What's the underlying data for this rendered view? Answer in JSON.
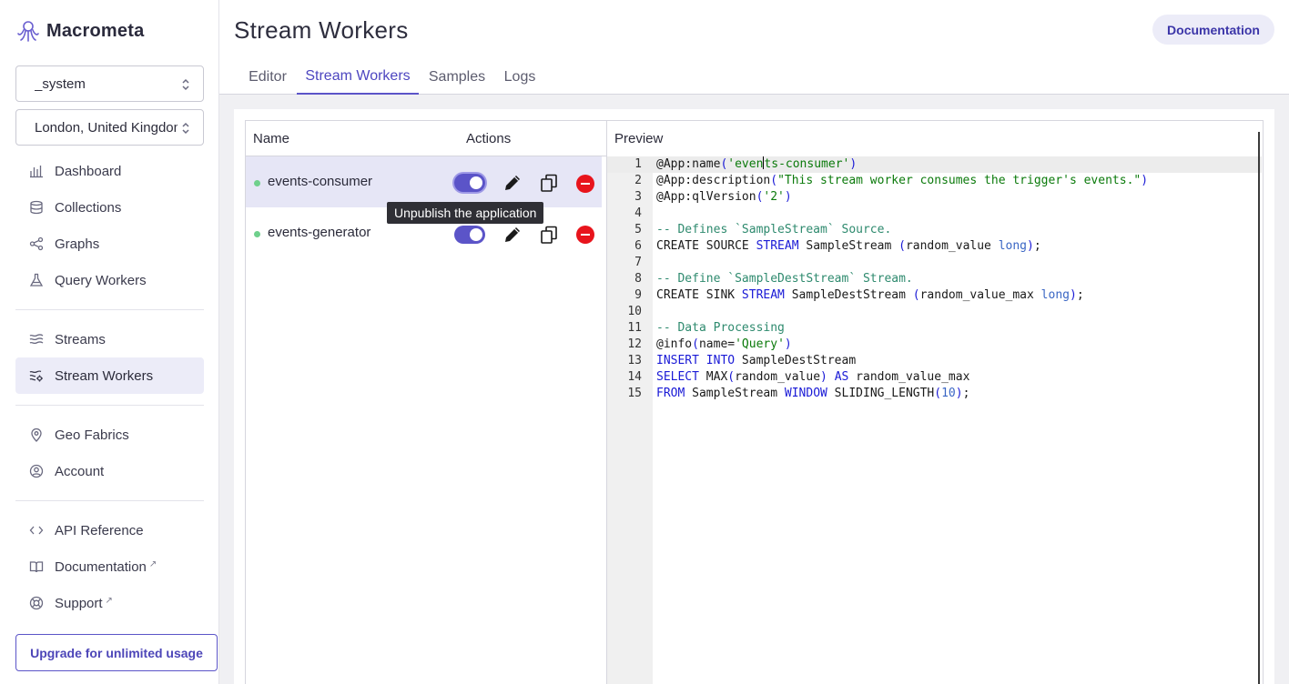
{
  "app": {
    "brand": "Macrometa"
  },
  "sidebar": {
    "database_select": "_system",
    "region_select": "London, United Kingdom",
    "nav_group1": [
      {
        "label": "Dashboard",
        "icon": "bar-chart-icon"
      },
      {
        "label": "Collections",
        "icon": "database-icon"
      },
      {
        "label": "Graphs",
        "icon": "graph-icon"
      },
      {
        "label": "Query Workers",
        "icon": "flask-icon"
      }
    ],
    "nav_group2": [
      {
        "label": "Streams",
        "icon": "waves-icon"
      },
      {
        "label": "Stream Workers",
        "icon": "stream-gear-icon",
        "active": true
      }
    ],
    "nav_group3": [
      {
        "label": "Geo Fabrics",
        "icon": "map-pin-icon"
      },
      {
        "label": "Account",
        "icon": "user-circle-icon"
      }
    ],
    "nav_group4": [
      {
        "label": "API Reference",
        "icon": "code-icon"
      },
      {
        "label": "Documentation",
        "icon": "book-icon",
        "external": true
      },
      {
        "label": "Support",
        "icon": "lifebuoy-icon",
        "external": true
      }
    ],
    "upgrade_label": "Upgrade for unlimited usage"
  },
  "header": {
    "title": "Stream Workers",
    "documentation_button": "Documentation"
  },
  "tabs": [
    {
      "label": "Editor"
    },
    {
      "label": "Stream Workers",
      "active": true
    },
    {
      "label": "Samples"
    },
    {
      "label": "Logs"
    }
  ],
  "table": {
    "col_name": "Name",
    "col_actions": "Actions",
    "rows": [
      {
        "name": "events-consumer",
        "status": "published",
        "selected": true
      },
      {
        "name": "events-generator",
        "status": "published",
        "selected": false
      }
    ],
    "tooltip": "Unpublish the application"
  },
  "preview": {
    "header": "Preview",
    "lines": [
      [
        [
          "tk-plain",
          "@App:name"
        ],
        [
          "tk-paren",
          "("
        ],
        [
          "tk-str",
          "'even"
        ],
        [
          "caret",
          ""
        ],
        [
          "tk-str",
          "ts-consumer'"
        ],
        [
          "tk-paren",
          ")"
        ]
      ],
      [
        [
          "tk-plain",
          "@App:description"
        ],
        [
          "tk-paren",
          "("
        ],
        [
          "tk-str",
          "\"This stream worker consumes the trigger's events.\""
        ],
        [
          "tk-paren",
          ")"
        ]
      ],
      [
        [
          "tk-plain",
          "@App:qlVersion"
        ],
        [
          "tk-paren",
          "("
        ],
        [
          "tk-str",
          "'2'"
        ],
        [
          "tk-paren",
          ")"
        ]
      ],
      [],
      [
        [
          "tk-comment",
          "-- Defines `SampleStream` Source."
        ]
      ],
      [
        [
          "tk-plain",
          "CREATE SOURCE "
        ],
        [
          "tk-kw",
          "STREAM"
        ],
        [
          "tk-plain",
          " SampleStream "
        ],
        [
          "tk-paren",
          "("
        ],
        [
          "tk-plain",
          "random_value "
        ],
        [
          "tk-type",
          "long"
        ],
        [
          "tk-paren",
          ")"
        ],
        [
          "tk-plain",
          ";"
        ]
      ],
      [],
      [
        [
          "tk-comment",
          "-- Define `SampleDestStream` Stream."
        ]
      ],
      [
        [
          "tk-plain",
          "CREATE SINK "
        ],
        [
          "tk-kw",
          "STREAM"
        ],
        [
          "tk-plain",
          " SampleDestStream "
        ],
        [
          "tk-paren",
          "("
        ],
        [
          "tk-plain",
          "random_value_max "
        ],
        [
          "tk-type",
          "long"
        ],
        [
          "tk-paren",
          ")"
        ],
        [
          "tk-plain",
          ";"
        ]
      ],
      [],
      [
        [
          "tk-comment",
          "-- Data Processing"
        ]
      ],
      [
        [
          "tk-plain",
          "@info"
        ],
        [
          "tk-paren",
          "("
        ],
        [
          "tk-plain",
          "name="
        ],
        [
          "tk-str",
          "'Query'"
        ],
        [
          "tk-paren",
          ")"
        ]
      ],
      [
        [
          "tk-kw",
          "INSERT INTO"
        ],
        [
          "tk-plain",
          " SampleDestStream"
        ]
      ],
      [
        [
          "tk-kw",
          "SELECT"
        ],
        [
          "tk-plain",
          " MAX"
        ],
        [
          "tk-paren",
          "("
        ],
        [
          "tk-plain",
          "random_value"
        ],
        [
          "tk-paren",
          ")"
        ],
        [
          "tk-plain",
          " "
        ],
        [
          "tk-kw",
          "AS"
        ],
        [
          "tk-plain",
          " random_value_max"
        ]
      ],
      [
        [
          "tk-kw",
          "FROM"
        ],
        [
          "tk-plain",
          " SampleStream "
        ],
        [
          "tk-kw",
          "WINDOW"
        ],
        [
          "tk-plain",
          " SLIDING_LENGTH"
        ],
        [
          "tk-paren",
          "("
        ],
        [
          "tk-type",
          "10"
        ],
        [
          "tk-paren",
          ")"
        ],
        [
          "tk-plain",
          ";"
        ]
      ]
    ]
  },
  "colors": {
    "accent": "#5b54c8",
    "status_dot": "#6fd08c",
    "delete": "#e8141c"
  }
}
